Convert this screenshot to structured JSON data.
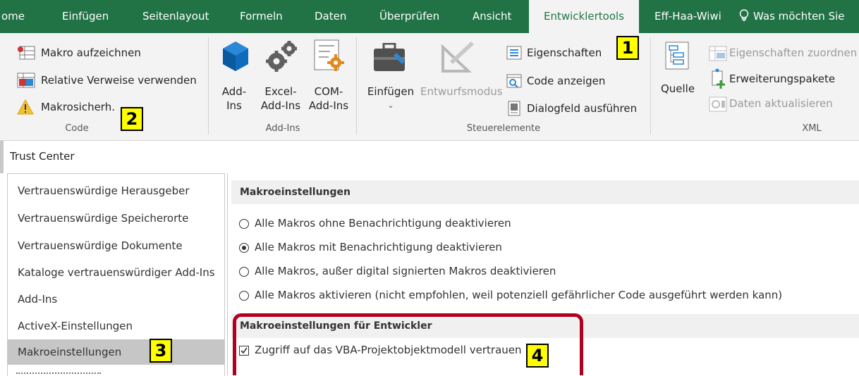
{
  "tabs": [
    {
      "label": "ome"
    },
    {
      "label": "Einfügen"
    },
    {
      "label": "Seitenlayout"
    },
    {
      "label": "Formeln"
    },
    {
      "label": "Daten"
    },
    {
      "label": "Überprüfen"
    },
    {
      "label": "Ansicht"
    },
    {
      "label": "Entwicklertools"
    },
    {
      "label": "Eff-Haa-Wiwi"
    },
    {
      "label": "Was möchten Sie"
    }
  ],
  "ribbon": {
    "code": {
      "macro_record": "Makro aufzeichnen",
      "relative_refs": "Relative Verweise verwenden",
      "macro_security": "Makrosicherh.",
      "caption": "Code"
    },
    "addins": {
      "addins_l1": "Add-",
      "addins_l2": "Ins",
      "excel_l1": "Excel-",
      "excel_l2": "Add-Ins",
      "com_l1": "COM-",
      "com_l2": "Add-Ins",
      "caption": "Add-Ins"
    },
    "controls": {
      "insert": "Einfügen",
      "design_mode": "Entwurfsmodus",
      "properties": "Eigenschaften",
      "view_code": "Code anzeigen",
      "run_dialog": "Dialogfeld ausführen",
      "caption": "Steuerelemente"
    },
    "xml": {
      "source": "Quelle",
      "map_properties": "Eigenschaften zuordnen",
      "expansion_packs": "Erweiterungspakete",
      "refresh_data": "Daten aktualisieren",
      "caption": "XML"
    }
  },
  "trust_center": {
    "title": "Trust Center",
    "sidebar": [
      {
        "label": "Vertrauenswürdige Herausgeber"
      },
      {
        "label": "Vertrauenswürdige Speicherorte"
      },
      {
        "label": "Vertrauenswürdige Dokumente"
      },
      {
        "label": "Kataloge vertrauenswürdiger Add-Ins"
      },
      {
        "label": "Add-Ins"
      },
      {
        "label": "ActiveX-Einstellungen"
      },
      {
        "label": "Makroeinstellungen"
      }
    ],
    "selected_item": "Makroeinstellungen",
    "macro_settings_header": "Makroeinstellungen",
    "options": [
      {
        "label": "Alle Makros ohne Benachrichtigung deaktivieren",
        "selected": false
      },
      {
        "label": "Alle Makros mit Benachrichtigung deaktivieren",
        "selected": true
      },
      {
        "label": "Alle Makros, außer digital signierten Makros deaktivieren",
        "selected": false
      },
      {
        "label": "Alle Makros aktivieren (nicht empfohlen, weil potenziell gefährlicher Code ausgeführt werden kann)",
        "selected": false
      }
    ],
    "developer_header": "Makroeinstellungen für Entwickler",
    "vba_access": {
      "label": "Zugriff auf das VBA-Projektobjektmodell vertrauen",
      "checked": true
    }
  },
  "annotations": [
    "1",
    "2",
    "3",
    "4"
  ],
  "colors": {
    "accent": "#217346",
    "annotation_bg": "#ffff00",
    "highlight_border": "#b00020"
  }
}
